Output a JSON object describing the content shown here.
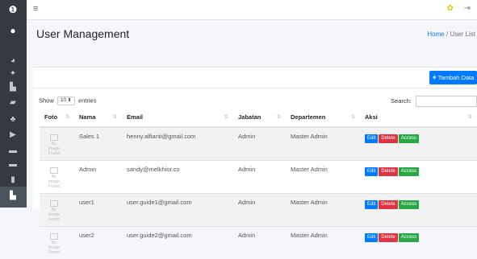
{
  "sidebar": {
    "icons": [
      "logo-icon",
      "user-avatar-icon",
      "dashboard-icon",
      "settings-icon",
      "folder-icon",
      "tag-icon",
      "users-icon",
      "truck-icon",
      "credit-card-icon",
      "credit-card-icon",
      "file-icon",
      "folder-icon"
    ]
  },
  "topbar": {
    "menu_icon": "≡",
    "bell": "✿",
    "logout": "⇥"
  },
  "header": {
    "title": "User Management",
    "breadcrumb_home": "Home",
    "breadcrumb_sep": "/",
    "breadcrumb_current": "User List"
  },
  "toolbar": {
    "add_label": "Tambah Data"
  },
  "datatable": {
    "show_label": "Show",
    "entries_value": "10",
    "entries_label": "entries",
    "search_label": "Search:"
  },
  "columns": [
    "Foto",
    "Nama",
    "Email",
    "Jabatan",
    "Departemen",
    "Aksi"
  ],
  "photo_placeholder": "No Image Found",
  "rows": [
    {
      "nama": "Sales 1",
      "email": "henny.alfianti@gmail.com",
      "jabatan": "Admin",
      "departemen": "Master Admin"
    },
    {
      "nama": "Admin",
      "email": "sandy@melkhior.co",
      "jabatan": "Admin",
      "departemen": "Master Admin"
    },
    {
      "nama": "user1",
      "email": "user.guide1@gmail.com",
      "jabatan": "Admin",
      "departemen": "Master Admin"
    },
    {
      "nama": "user2",
      "email": "user.guide2@gmail.com",
      "jabatan": "Admin",
      "departemen": "Master Admin"
    }
  ],
  "actions": {
    "edit": "Edit",
    "delete": "Delete",
    "access": "Access"
  },
  "colors": {
    "sidebar": "#343a40",
    "primary": "#007bff",
    "danger": "#dc3545",
    "success": "#28a745"
  }
}
